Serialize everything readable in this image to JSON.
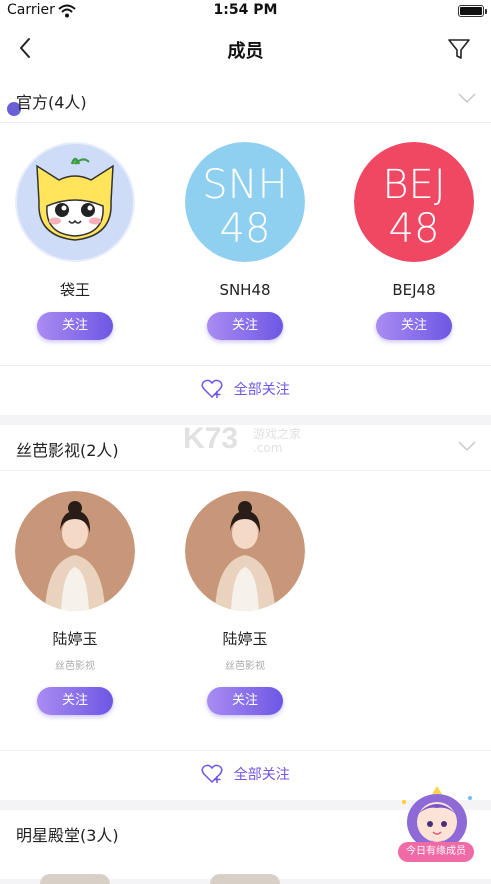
{
  "status_bar": {
    "carrier": "Carrier",
    "time": "1:54 PM"
  },
  "nav": {
    "title": "成员"
  },
  "sections": [
    {
      "title": "官方(4人)",
      "members": [
        {
          "name": "袋王",
          "follow": "关注"
        },
        {
          "name": "SNH48",
          "follow": "关注",
          "logo_lines": [
            "SNH",
            "48"
          ],
          "logo_color": "#8fd0f1"
        },
        {
          "name": "BEJ48",
          "follow": "关注",
          "logo_lines": [
            "BEJ",
            "48"
          ],
          "logo_color": "#f04863"
        }
      ],
      "follow_all": "全部关注"
    },
    {
      "title": "丝芭影视(2人)",
      "members": [
        {
          "name": "陆婷玉",
          "subtitle": "丝芭影视",
          "follow": "关注"
        },
        {
          "name": "陆婷玉",
          "subtitle": "丝芭影视",
          "follow": "关注"
        }
      ],
      "follow_all": "全部关注"
    },
    {
      "title": "明星殿堂(3人)"
    }
  ],
  "watermark": {
    "brand": "K73",
    "right_text": "游戏之家",
    "domain": ".com"
  },
  "float_badge": {
    "label": "今日有缘成员"
  },
  "colors": {
    "accent": "#6e57e4",
    "accent_light": "#a98cf2",
    "snh": "#8fd0f1",
    "bej": "#f04863"
  }
}
